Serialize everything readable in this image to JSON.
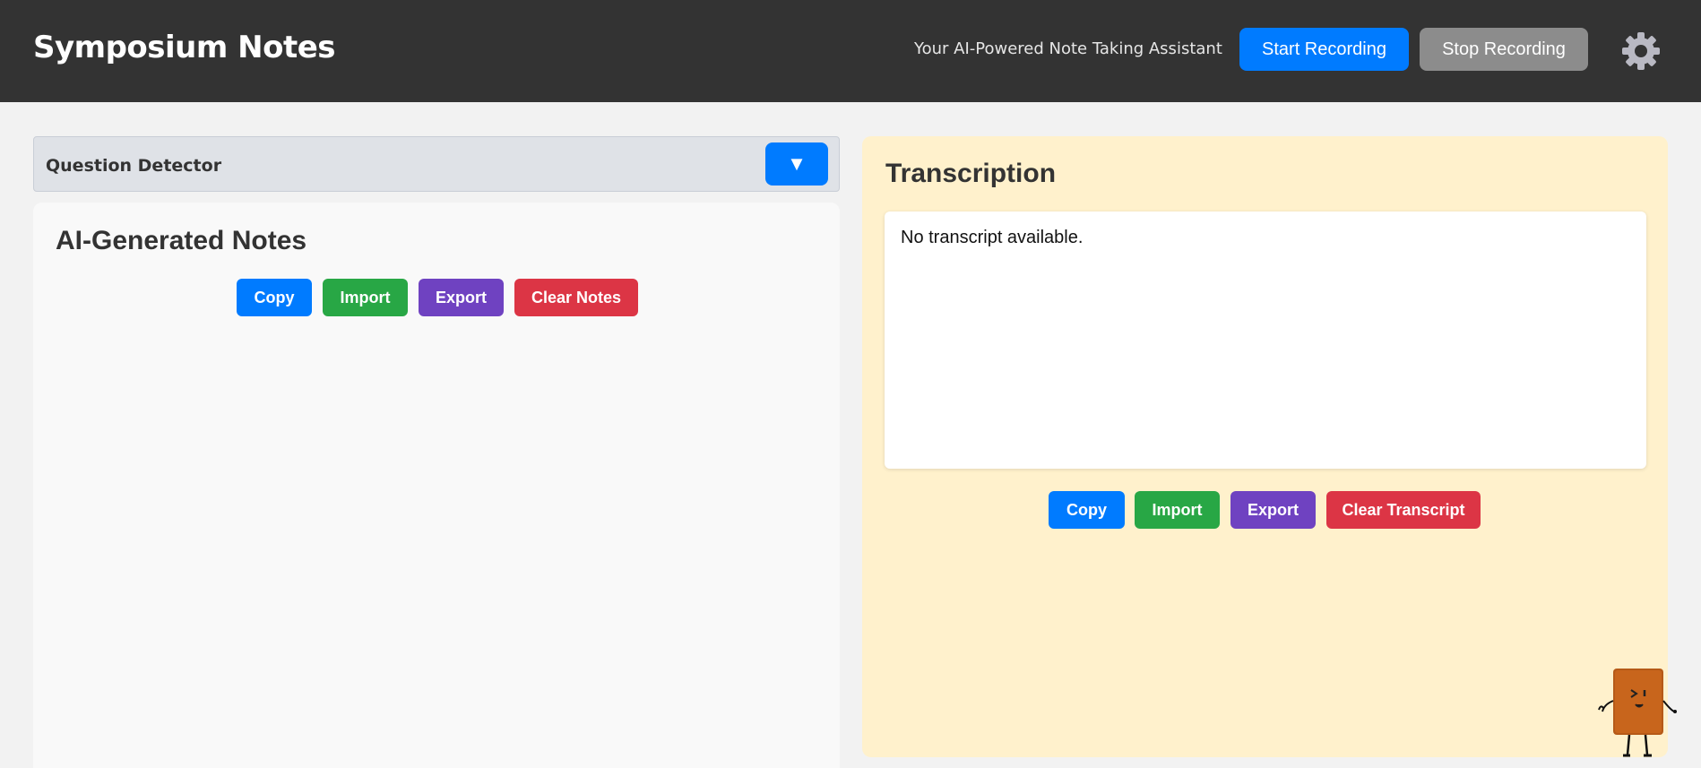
{
  "header": {
    "title": "Symposium Notes",
    "tagline": "Your AI-Powered Note Taking Assistant",
    "start_label": "Start Recording",
    "stop_label": "Stop Recording",
    "settings_icon": "gear-icon"
  },
  "question_detector": {
    "label": "Question Detector",
    "toggle_symbol": "▼"
  },
  "notes": {
    "title": "AI-Generated Notes",
    "copy_label": "Copy",
    "import_label": "Import",
    "export_label": "Export",
    "clear_label": "Clear Notes"
  },
  "transcription": {
    "title": "Transcription",
    "content": "No transcript available.",
    "copy_label": "Copy",
    "import_label": "Import",
    "export_label": "Export",
    "clear_label": "Clear Transcript"
  },
  "colors": {
    "header_bg": "#333333",
    "primary": "#007bff",
    "success": "#28a745",
    "purple": "#6f42c1",
    "danger": "#dc3545",
    "transcription_bg": "#fff1cc"
  },
  "mascot_icon": "toast-mascot-icon"
}
